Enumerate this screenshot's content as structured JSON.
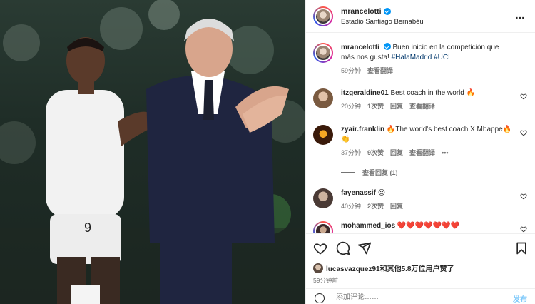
{
  "post": {
    "username": "mrancelotti",
    "location": "Estadio Santiago Bernabéu",
    "more_icon": "⋯"
  },
  "caption": {
    "username": "mrancelotti",
    "text": "Buen inicio en la competición que más nos gusta!",
    "hashtag1": "#HalaMadrid",
    "hashtag2": "#UCL",
    "time": "59分钟",
    "translate": "查看翻译"
  },
  "comments": [
    {
      "username": "itzgeraldine01",
      "text": "Best coach in the world 🔥",
      "time": "20分钟",
      "likes": "1次赞",
      "reply": "回复",
      "translate": "查看翻译"
    },
    {
      "username": "zyair.franklin",
      "text": "🔥The world's best coach X Mbappe🔥👏",
      "time": "37分钟",
      "likes": "9次赞",
      "reply": "回复",
      "translate": "查看翻译",
      "more": "•••"
    },
    {
      "username": "fayenassif",
      "text": "😍",
      "time": "40分钟",
      "likes": "2次赞",
      "reply": "回复"
    },
    {
      "username": "mohammed_ios",
      "text": "❤️❤️❤️❤️❤️❤️❤️"
    }
  ],
  "view_replies": "查看回复 (1)",
  "likes_line": "lucasvazquez91和其他5.8万位用户赞了",
  "post_time": "59分钟前",
  "add_comment_placeholder": "添加评论……",
  "post_button": "发布",
  "colors": {
    "accent": "#0095f6",
    "text": "#262626",
    "muted": "#737373",
    "link": "#00376b"
  },
  "icons": [
    "heart-icon",
    "comment-icon",
    "share-icon",
    "bookmark-icon",
    "more-icon",
    "verified-icon",
    "emoji-icon"
  ]
}
